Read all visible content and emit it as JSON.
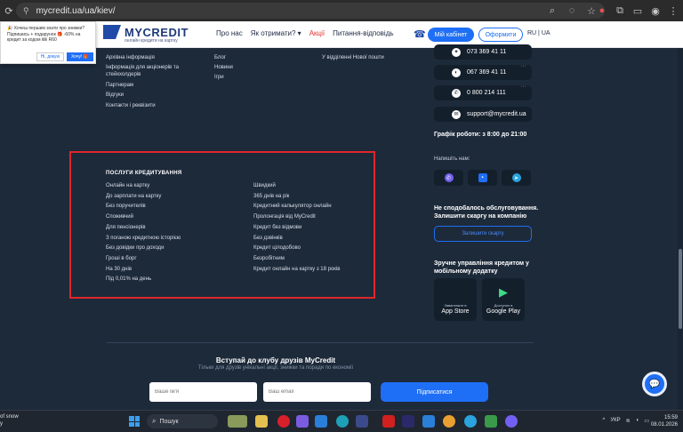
{
  "browser": {
    "url": "mycredit.ua/ua/kiev/",
    "back_icon": "arrow-left-icon",
    "reload_icon": "reload-icon",
    "lock_icon": "lock-icon"
  },
  "header": {
    "logo_text": "MYCREDIT",
    "logo_sub": "онлайн кредити на картку",
    "menu": [
      "Про нас",
      "Як отримати? ▾",
      "Акції",
      "Питання-відповідь"
    ],
    "cabinet": "Мій кабінет",
    "register": "Оформити",
    "lang": "RU | UA"
  },
  "notification": {
    "text": "🎉 Хочеш першим знати про знижки? Підпишись + подарунок 🎁 -60% на кредит за кодом 🎟 R60",
    "no": "Ні, дякую",
    "yes": "Хочу! 🎁"
  },
  "footer_links": {
    "col1": [
      "Архівна інформація",
      "Інформація для акціонерів та",
      "стейкхолдерів",
      "Партнерам",
      "Відгуки",
      "Контакти і реквізити"
    ],
    "col2": [
      "Блог",
      "Новини",
      "Ігри"
    ],
    "col3": [
      "У відділенні Нової пошти"
    ]
  },
  "contacts": [
    {
      "value": "073 369 41 11",
      "icon": "kyivstar-icon"
    },
    {
      "value": "067 369 41 11",
      "icon": "lifecell-icon"
    },
    {
      "value": "0 800 214 111",
      "icon": "phone-icon"
    },
    {
      "value": "support@mycredit.ua",
      "icon": "mail-icon"
    }
  ],
  "schedule": "Графік роботи: з 8:00 до 21:00",
  "write_us": "Напишіть нам:",
  "not_satisfied": "Не сподобалось обслуговування. Залишити скаргу на компанію",
  "complaint_btn": "Залишити скаргу",
  "app_title": "Зручне управління кредитом у мобільному додатку",
  "stores": [
    {
      "small": "Завантажте в",
      "big": "App Store"
    },
    {
      "small": "Доступно в",
      "big": "Google Play"
    }
  ],
  "services": {
    "title": "ПОСЛУГИ КРЕДИТУВАННЯ",
    "left": [
      "Онлайн на картку",
      "До зарплати на картку",
      "Без поручителів",
      "Споживчий",
      "Для пенсіонерів",
      "З поганою кредитною історією",
      "Без довідки про доходи",
      "Гроші в борг",
      "На 30 днів",
      "Під 0,01% на день"
    ],
    "right": [
      "Швидкий",
      "365 днів на рік",
      "Кредитний калькулятор онлайн",
      "Пролонгація від MyCredit",
      "Кредит без відмови",
      "Без дзвінків",
      "Кредит цілодобово",
      "Безробітним",
      "Кредит онлайн на картку з 18 років"
    ]
  },
  "subscribe": {
    "title": "Вступай до клубу друзів MyCredit",
    "desc": "Тільки для друзів унікальні акції, знижки та поради по економії",
    "name_placeholder": "Ваше ім'я",
    "email_placeholder": "Ваш email",
    "button": "Підписатися"
  },
  "taskbar": {
    "left_line1": "of snow",
    "left_line2": "y",
    "search": "Пошук",
    "lang": "УКР",
    "time": "15:59",
    "date": "08.01.2026"
  }
}
